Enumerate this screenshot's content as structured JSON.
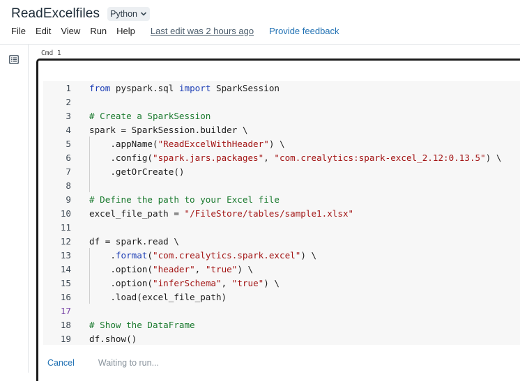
{
  "notebook": {
    "title": "ReadExcelfiles",
    "language": "Python"
  },
  "menu": {
    "items": [
      "File",
      "Edit",
      "View",
      "Run",
      "Help"
    ],
    "last_edit": "Last edit was 2 hours ago",
    "feedback": "Provide feedback"
  },
  "cell": {
    "cmd_label": "Cmd 1",
    "active_line": 17,
    "lines": [
      {
        "n": "1",
        "code": [
          {
            "t": "kw",
            "v": "from"
          },
          {
            "t": "p",
            "v": " pyspark.sql "
          },
          {
            "t": "kw",
            "v": "import"
          },
          {
            "t": "p",
            "v": " SparkSession"
          }
        ]
      },
      {
        "n": "2",
        "code": []
      },
      {
        "n": "3",
        "code": [
          {
            "t": "cm",
            "v": "# Create a SparkSession"
          }
        ]
      },
      {
        "n": "4",
        "code": [
          {
            "t": "p",
            "v": "spark = SparkSession.builder \\"
          }
        ]
      },
      {
        "n": "5",
        "code": [
          {
            "t": "p",
            "v": "    .appName("
          },
          {
            "t": "str",
            "v": "\"ReadExcelWithHeader\""
          },
          {
            "t": "p",
            "v": ") \\"
          }
        ]
      },
      {
        "n": "6",
        "code": [
          {
            "t": "p",
            "v": "    .config("
          },
          {
            "t": "str",
            "v": "\"spark.jars.packages\""
          },
          {
            "t": "p",
            "v": ", "
          },
          {
            "t": "str",
            "v": "\"com.crealytics:spark-excel_2.12:0.13.5\""
          },
          {
            "t": "p",
            "v": ") \\"
          }
        ]
      },
      {
        "n": "7",
        "code": [
          {
            "t": "p",
            "v": "    .getOrCreate()"
          }
        ]
      },
      {
        "n": "8",
        "code": []
      },
      {
        "n": "9",
        "code": [
          {
            "t": "cm",
            "v": "# Define the path to your Excel file"
          }
        ]
      },
      {
        "n": "10",
        "code": [
          {
            "t": "p",
            "v": "excel_file_path = "
          },
          {
            "t": "str",
            "v": "\"/FileStore/tables/sample1.xlsx\""
          }
        ]
      },
      {
        "n": "11",
        "code": []
      },
      {
        "n": "12",
        "code": [
          {
            "t": "p",
            "v": "df = spark.read \\"
          }
        ]
      },
      {
        "n": "13",
        "code": [
          {
            "t": "p",
            "v": "    ."
          },
          {
            "t": "kw",
            "v": "format"
          },
          {
            "t": "p",
            "v": "("
          },
          {
            "t": "str",
            "v": "\"com.crealytics.spark.excel\""
          },
          {
            "t": "p",
            "v": ") \\"
          }
        ]
      },
      {
        "n": "14",
        "code": [
          {
            "t": "p",
            "v": "    .option("
          },
          {
            "t": "str",
            "v": "\"header\""
          },
          {
            "t": "p",
            "v": ", "
          },
          {
            "t": "str",
            "v": "\"true\""
          },
          {
            "t": "p",
            "v": ") \\"
          }
        ]
      },
      {
        "n": "15",
        "code": [
          {
            "t": "p",
            "v": "    .option("
          },
          {
            "t": "str",
            "v": "\"inferSchema\""
          },
          {
            "t": "p",
            "v": ", "
          },
          {
            "t": "str",
            "v": "\"true\""
          },
          {
            "t": "p",
            "v": ") \\"
          }
        ]
      },
      {
        "n": "16",
        "code": [
          {
            "t": "p",
            "v": "    .load(excel_file_path)"
          }
        ]
      },
      {
        "n": "17",
        "code": []
      },
      {
        "n": "18",
        "code": [
          {
            "t": "cm",
            "v": "# Show the DataFrame"
          }
        ]
      },
      {
        "n": "19",
        "code": [
          {
            "t": "p",
            "v": "df.show()"
          }
        ]
      }
    ]
  },
  "footer": {
    "cancel": "Cancel",
    "status": "Waiting to run..."
  }
}
